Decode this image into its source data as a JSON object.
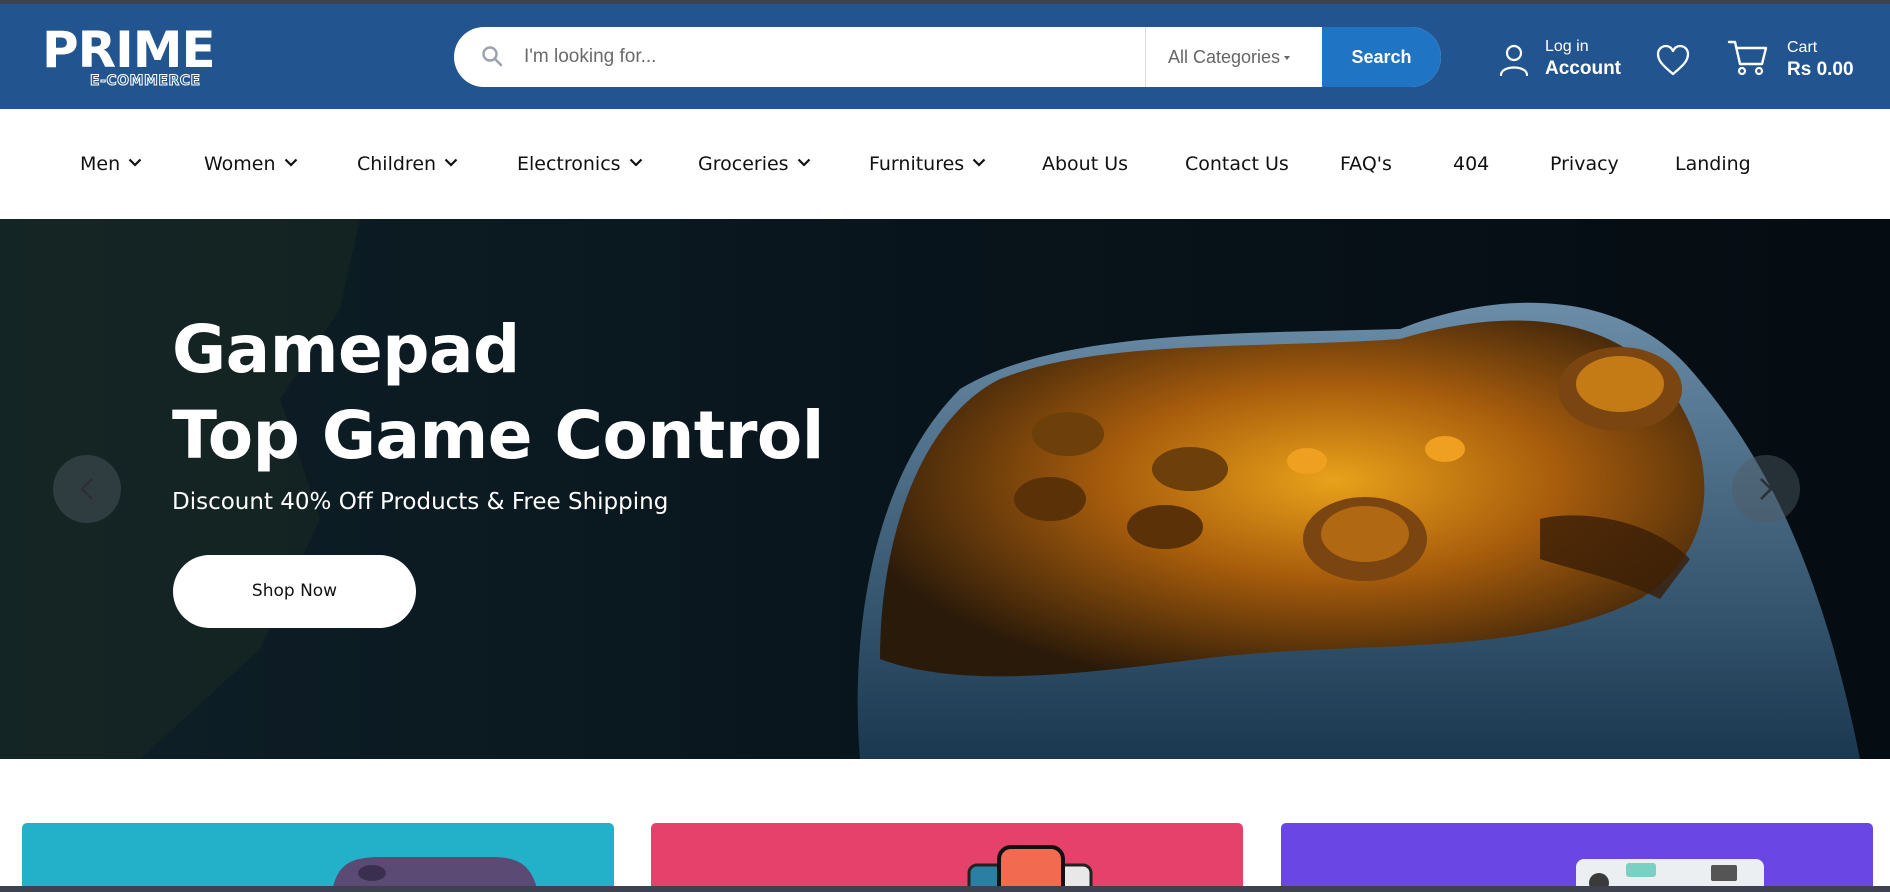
{
  "brand": {
    "name": "PRIME",
    "tagline": "E-COMMERCE"
  },
  "search": {
    "placeholder": "I'm looking for...",
    "category": "All Categories",
    "button": "Search"
  },
  "account": {
    "small": "Log in",
    "big": "Account"
  },
  "cart": {
    "small": "Cart",
    "total": "Rs 0.00"
  },
  "nav": [
    {
      "label": "Men",
      "dropdown": true
    },
    {
      "label": "Women",
      "dropdown": true
    },
    {
      "label": "Children",
      "dropdown": true
    },
    {
      "label": "Electronics",
      "dropdown": true
    },
    {
      "label": "Groceries",
      "dropdown": true
    },
    {
      "label": "Furnitures",
      "dropdown": true
    },
    {
      "label": "About Us",
      "dropdown": false
    },
    {
      "label": "Contact Us",
      "dropdown": false
    },
    {
      "label": "FAQ's",
      "dropdown": false
    },
    {
      "label": "404",
      "dropdown": false
    },
    {
      "label": "Privacy",
      "dropdown": false
    },
    {
      "label": "Landing",
      "dropdown": false
    }
  ],
  "hero": {
    "title_line1": "Gamepad",
    "title_line2": "Top Game Control",
    "subtitle": "Discount 40% Off Products & Free Shipping",
    "cta": "Shop Now"
  },
  "icons": {
    "search": "search-icon",
    "user": "user-icon",
    "heart": "heart-icon",
    "cart": "cart-icon",
    "chevron": "chevron-down-icon",
    "prev": "chevron-left-icon",
    "next": "chevron-right-icon"
  },
  "colors": {
    "header": "#22558f",
    "search_button": "#1f74c3",
    "card_1": "#23b1c9",
    "card_2": "#e6416b",
    "card_3": "#6a47e4"
  }
}
